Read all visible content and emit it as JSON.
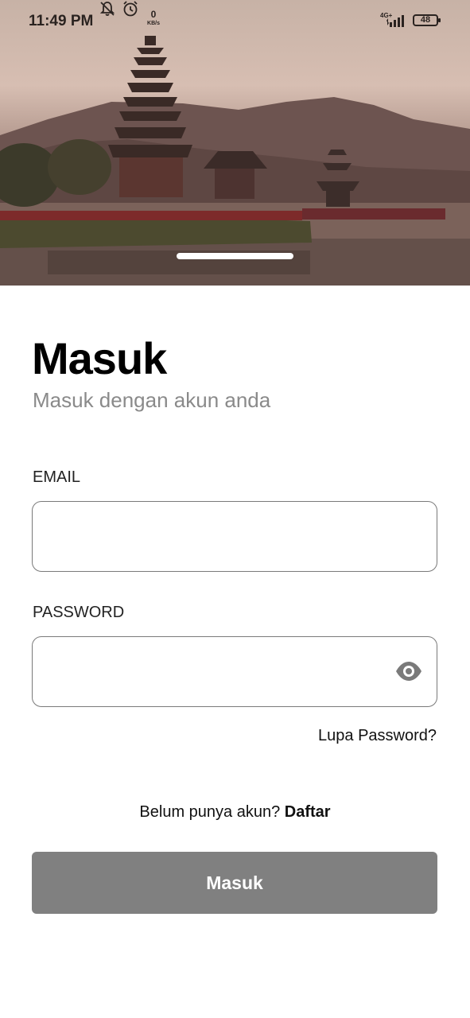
{
  "status_bar": {
    "time": "11:49 PM",
    "net_speed": "0",
    "net_unit": "KB/s",
    "network": "4G+",
    "battery": "48"
  },
  "hero": {
    "image": "temple-lake-landscape"
  },
  "login": {
    "title": "Masuk",
    "subtitle": "Masuk dengan akun anda",
    "email_label": "EMAIL",
    "email_value": "",
    "password_label": "PASSWORD",
    "password_value": "",
    "forgot_password": "Lupa Password?",
    "no_account_text": "Belum punya akun?",
    "register_link": "Daftar",
    "submit_label": "Masuk"
  },
  "colors": {
    "button": "#808080",
    "subtitle": "#8a8a8a",
    "field_border": "#7a7a7a"
  }
}
